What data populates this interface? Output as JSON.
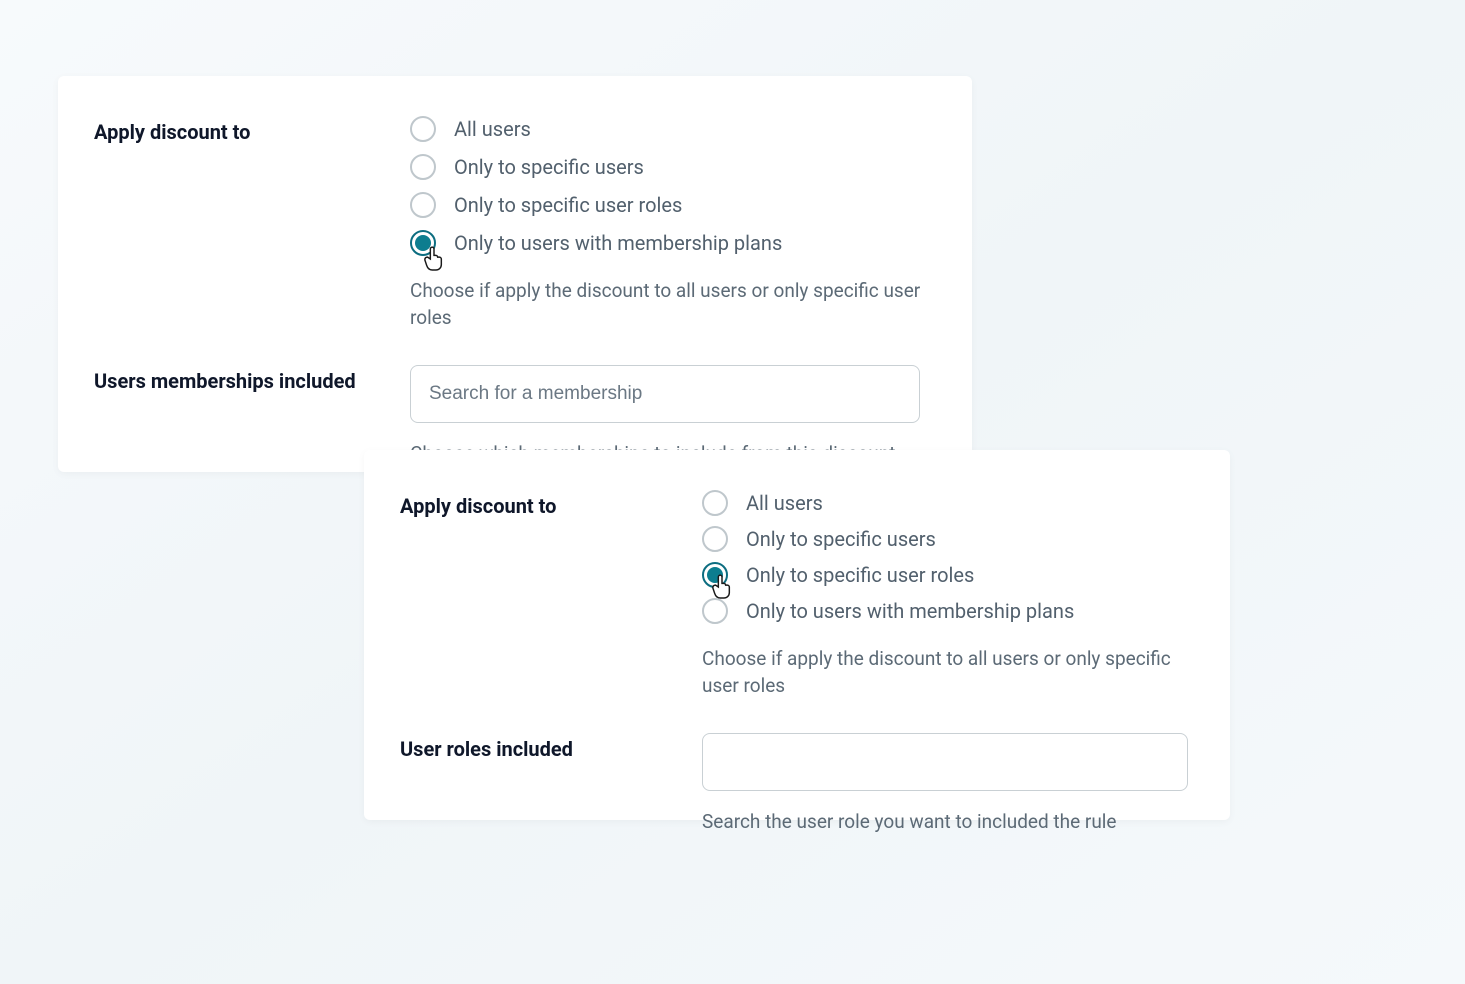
{
  "panel1": {
    "section1_label": "Apply discount to",
    "radios": [
      {
        "label": "All users",
        "checked": false
      },
      {
        "label": "Only to specific users",
        "checked": false
      },
      {
        "label": "Only to specific user roles",
        "checked": false
      },
      {
        "label": "Only to users with membership plans",
        "checked": true
      }
    ],
    "section1_help": "Choose if apply the discount to all users or only specific user roles",
    "section2_label": "Users memberships included",
    "search_placeholder": "Search for a membership",
    "section2_help": "Choose which memberships to include from this discount"
  },
  "panel2": {
    "section1_label": "Apply discount to",
    "radios": [
      {
        "label": "All users",
        "checked": false
      },
      {
        "label": "Only to specific users",
        "checked": false
      },
      {
        "label": "Only to specific user roles",
        "checked": true
      },
      {
        "label": "Only to users with membership plans",
        "checked": false
      }
    ],
    "section1_help": "Choose if apply the discount to all users or only specific user roles",
    "section2_label": "User roles included",
    "search_placeholder": "",
    "section2_help": "Search the user role you want to included the rule"
  }
}
